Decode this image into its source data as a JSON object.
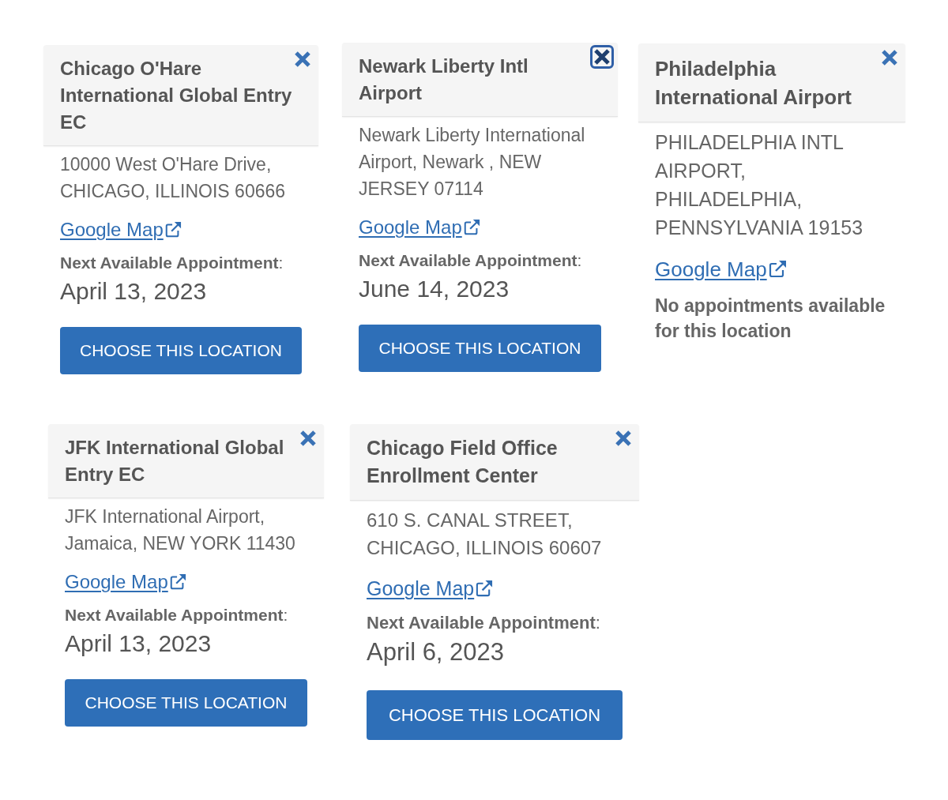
{
  "locations": [
    {
      "kind": "available",
      "title": "Chicago O'Hare International Global Entry EC",
      "close_focused": false,
      "address": "10000 West O'Hare Drive, CHICAGO, ILLINOIS 60666",
      "map_link": "Google Map",
      "appointment_label": "**Next Available Appointment**:",
      "appointment_date": "April 13, 2023",
      "button": "CHOOSE THIS LOCATION"
    },
    {
      "kind": "available",
      "title": "Newark Liberty Intl Airport",
      "close_focused": true,
      "address": "Newark Liberty International Airport, Newark , NEW JERSEY 07114",
      "map_link": "Google Map",
      "appointment_label": "**Next Available Appointment**:",
      "appointment_date": "June 14, 2023",
      "button": "CHOOSE THIS LOCATION"
    },
    {
      "kind": "unavailable",
      "title": "Philadelphia International Airport",
      "close_focused": false,
      "address": "PHILADELPHIA INTL AIRPORT, PHILADELPHIA, PENNSYLVANIA 19153",
      "map_link": "Google Map",
      "message": "No appointments available for this location"
    },
    {
      "kind": "available",
      "title": "JFK International Global Entry EC",
      "close_focused": false,
      "address": "JFK International Airport, Jamaica, NEW YORK 11430",
      "map_link": "Google Map",
      "appointment_label": "**Next Available Appointment**:",
      "appointment_date": "April 13, 2023",
      "button": "CHOOSE THIS LOCATION"
    },
    {
      "kind": "available",
      "title": "Chicago Field Office Enrollment Center",
      "close_focused": false,
      "address": "610 S. CANAL STREET, CHICAGO, ILLINOIS 60607",
      "map_link": "Google Map",
      "appointment_label": "**Next Available Appointment**:",
      "appointment_date": "April 6, 2023",
      "button": "CHOOSE THIS LOCATION"
    }
  ]
}
